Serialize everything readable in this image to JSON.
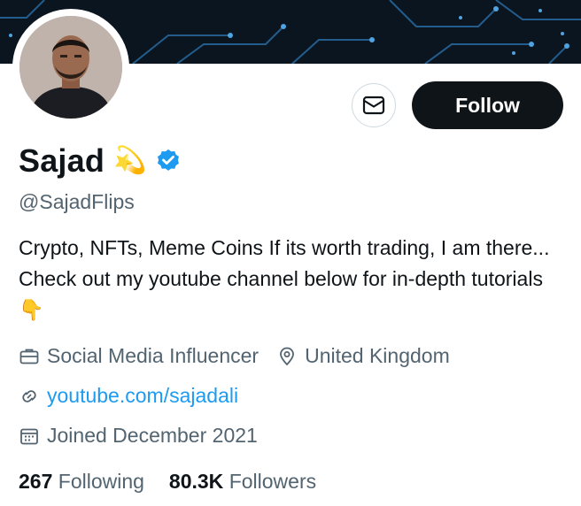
{
  "profile": {
    "name": "Sajad",
    "name_emoji": "💫",
    "handle": "@SajadFlips",
    "bio_text": "Crypto, NFTs, Meme Coins  If its worth trading, I am there...  Check out my youtube channel below for in-depth tutorials",
    "bio_emoji": "👇",
    "category": "Social Media Influencer",
    "location": "United Kingdom",
    "website": "youtube.com/sajadali",
    "joined": "Joined December 2021"
  },
  "actions": {
    "follow_label": "Follow"
  },
  "stats": {
    "following_count": "267",
    "following_label": "Following",
    "followers_count": "80.3K",
    "followers_label": "Followers"
  },
  "colors": {
    "verified": "#1d9bf0",
    "link": "#1d9bf0",
    "follow_bg": "#0f1419",
    "banner": "#0b1520"
  },
  "icons": {
    "message": "envelope-icon",
    "verified": "verified-badge-icon",
    "category": "briefcase-icon",
    "location": "location-pin-icon",
    "website": "link-icon",
    "joined": "calendar-icon"
  }
}
